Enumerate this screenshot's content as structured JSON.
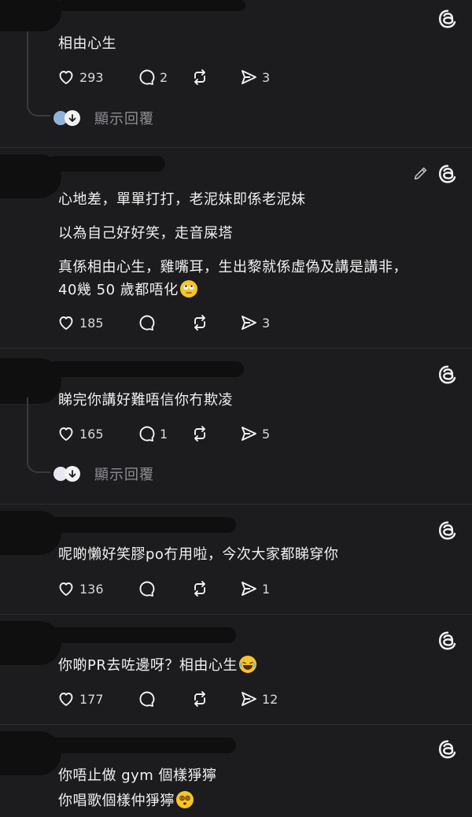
{
  "posts": [
    {
      "lines": [
        "相由心生"
      ],
      "likes": "293",
      "replies": "2",
      "shares": "3",
      "show_replies": "顯示回覆"
    },
    {
      "lines": [
        "心地差，單單打打，老泥妹即係老泥妹",
        "以為自己好好笑，走音屎塔",
        "真係相由心生，雞嘴耳，生出黎就係虛偽及講是講非，",
        "40幾 50 歲都唔化"
      ],
      "likes": "185",
      "replies": "",
      "shares": "3"
    },
    {
      "lines": [
        "睇完你講好難唔信你冇欺凌"
      ],
      "likes": "165",
      "replies": "1",
      "shares": "5",
      "show_replies": "顯示回覆"
    },
    {
      "lines": [
        "呢啲懶好笑膠po冇用啦，今次大家都睇穿你"
      ],
      "likes": "136",
      "replies": "",
      "shares": "1"
    },
    {
      "lines": [
        "你啲PR去咗邊呀？相由心生"
      ],
      "likes": "177",
      "replies": "",
      "shares": "12"
    },
    {
      "lines": [
        "你唔止做 gym 個樣猙獰",
        "你唱歌個樣仲猙獰"
      ]
    }
  ],
  "icons": {
    "threads": "threads-logo-icon",
    "like": "heart-icon",
    "reply": "speech-bubble-icon",
    "repost": "repost-icon",
    "share": "send-icon",
    "edit": "pencil-icon"
  },
  "colors": {
    "background": "#1c1c1e",
    "text": "#f0f0f0",
    "muted": "#8e8e93"
  }
}
